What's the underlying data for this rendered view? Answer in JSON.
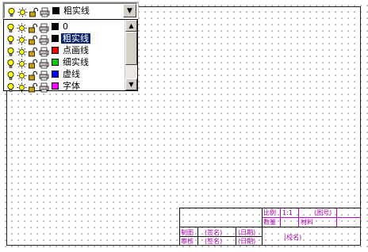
{
  "combo": {
    "current_layer": "粗实线",
    "current_color": "#000000",
    "arrow": "▼"
  },
  "layers": [
    {
      "name": "0",
      "color": "#000000",
      "selected": false
    },
    {
      "name": "粗实线",
      "color": "#000000",
      "selected": true
    },
    {
      "name": "点画线",
      "color": "#ff0000",
      "selected": false
    },
    {
      "name": "细实线",
      "color": "#00cc00",
      "selected": false
    },
    {
      "name": "虚线",
      "color": "#0000ff",
      "selected": false
    },
    {
      "name": "字体",
      "color": "#ff00ff",
      "selected": false
    }
  ],
  "layer_state_icons": [
    "lightbulb-on-icon",
    "sun-thaw-icon",
    "unlock-icon",
    "printer-icon"
  ],
  "scrollbar": {
    "up": "▲",
    "down": "▼"
  },
  "title_block": {
    "scale_label": "比例",
    "scale_value": "1:1",
    "drawing_no": "(图号)",
    "quantity_label": "数量",
    "material_label": "材料",
    "drawn_label": "制图",
    "drawn_sign": "(签名)",
    "drawn_date": "(日期)",
    "checked_label": "审核",
    "checked_sign": "(签名)",
    "checked_date": "(日期)",
    "school": "(校名)"
  }
}
